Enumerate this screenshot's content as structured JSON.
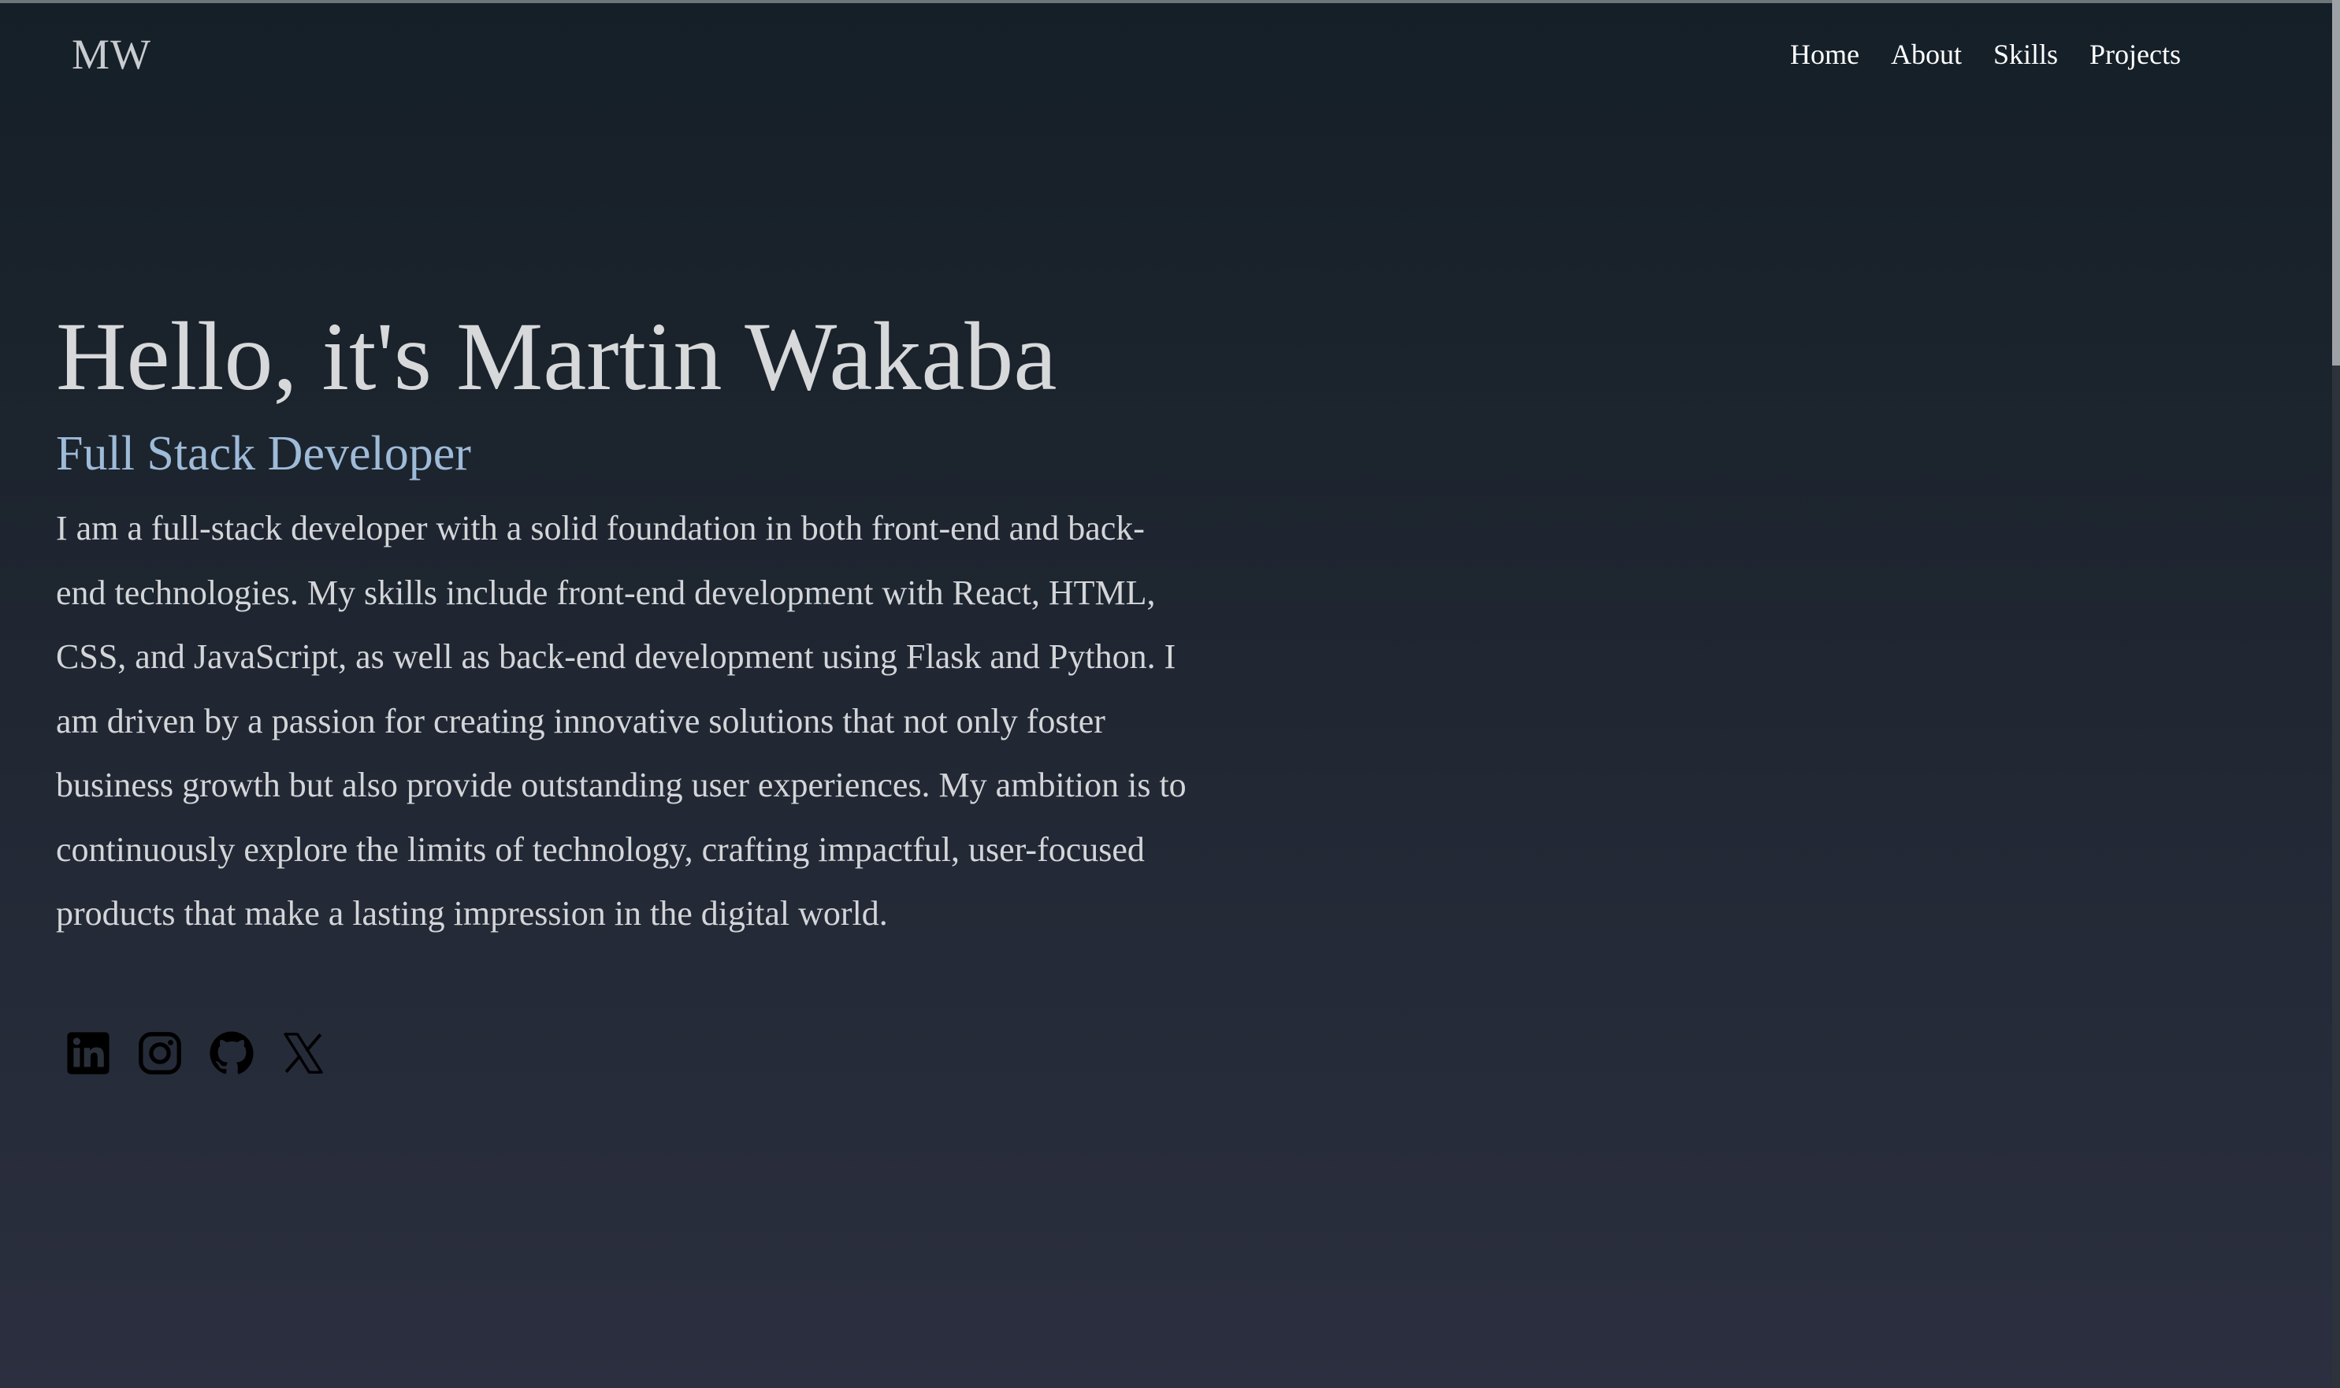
{
  "header": {
    "logo": "MW",
    "nav": [
      "Home",
      "About",
      "Skills",
      "Projects"
    ]
  },
  "hero": {
    "greeting": "Hello, it's Martin Wakaba",
    "role": "Full Stack Developer",
    "bio": "I am a full-stack developer with a solid foundation in both front-end and back-end technologies. My skills include front-end development with React, HTML, CSS, and JavaScript, as well as back-end development using Flask and Python. I am driven by a passion for creating innovative solutions that not only foster business growth but also provide outstanding user experiences. My ambition is to continuously explore the limits of technology, crafting impactful, user-focused products that make a lasting impression in the digital world."
  },
  "socials": [
    {
      "icon": "linkedin-icon"
    },
    {
      "icon": "instagram-icon"
    },
    {
      "icon": "github-icon"
    },
    {
      "icon": "x-twitter-icon"
    }
  ],
  "colors": {
    "background_top": "#151f27",
    "background_bottom": "#2b2f3f",
    "heading": "#d7d8da",
    "accent": "#9ebbd8",
    "nav_text": "#ffffff",
    "icon": "#000000"
  }
}
